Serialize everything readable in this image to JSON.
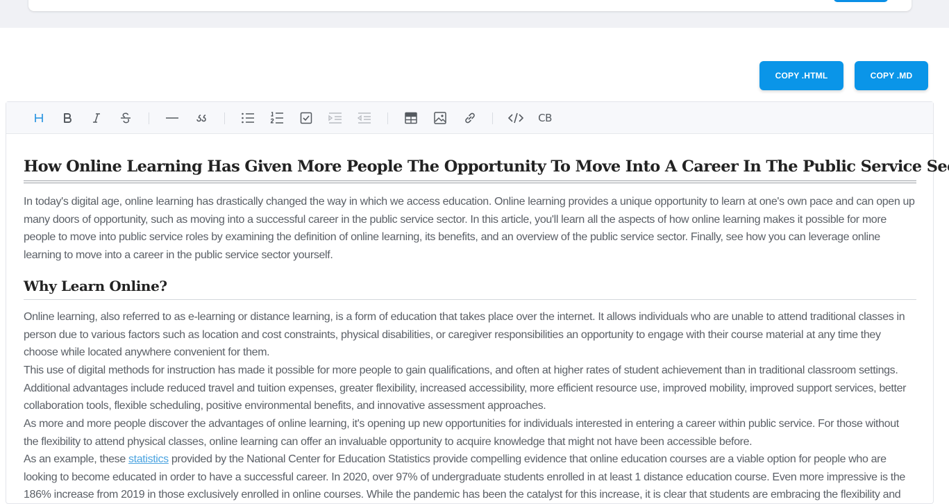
{
  "toolbar_actions": {
    "copy_html": "COPY .HTML",
    "copy_md": "COPY .MD"
  },
  "editor_toolbar": {
    "code_block_label": "CB",
    "active_color": "#1e90e0",
    "icon_color": "#555a60",
    "disabled_color": "#b9bcc2"
  },
  "document": {
    "title": "How Online Learning Has Given More People The Opportunity To Move Into A Career In The Public Service Sector",
    "intro": "In today's digital age, online learning has drastically changed the way in which we access education. Online learning provides a unique opportunity to learn at one's own pace and can open up many doors of opportunity, such as moving into a successful career in the public service sector. In this article, you'll learn all the aspects of how online learning makes it possible for more people to move into public service roles by examining the definition of online learning, its benefits, and an overview of the public service sector. Finally, see how you can leverage online learning to move into a career in the public service sector yourself.",
    "section_heading": "Why Learn Online?",
    "paragraphs": [
      "Online learning, also referred to as e-learning or distance learning, is a form of education that takes place over the internet. It allows individuals who are unable to attend traditional classes in person due to various factors such as location and cost constraints, physical disabilities, or caregiver responsibilities an opportunity to engage with their course material at any time they choose while located anywhere convenient for them.",
      "This use of digital methods for instruction has made it possible for more people to gain qualifications, and often at higher rates of student achievement than in traditional classroom settings. Additional advantages include reduced travel and tuition expenses, greater flexibility, increased accessibility, more efficient resource use, improved mobility, improved support services, better collaboration tools, flexible scheduling, positive environmental benefits, and innovative assessment approaches.",
      "As more and more people discover the advantages of online learning, it's opening up new opportunities for individuals interested in entering a career within public service. For those without the flexibility to attend physical classes, online learning can offer an invaluable opportunity to acquire knowledge that might not have been accessible before."
    ],
    "example_prefix": "As an example, these ",
    "example_link": "statistics",
    "example_suffix": " provided by the National Center for Education Statistics provide compelling evidence that online education courses are a viable option for people who are looking to become educated in order to have a successful career. In 2020, over 97% of undergraduate students enrolled in at least 1 distance education course. Even more impressive is the 186% increase from 2019 in those exclusively enrolled in online courses. While the pandemic has been the catalyst for this increase, it is clear that students are embracing the flexibility and"
  }
}
